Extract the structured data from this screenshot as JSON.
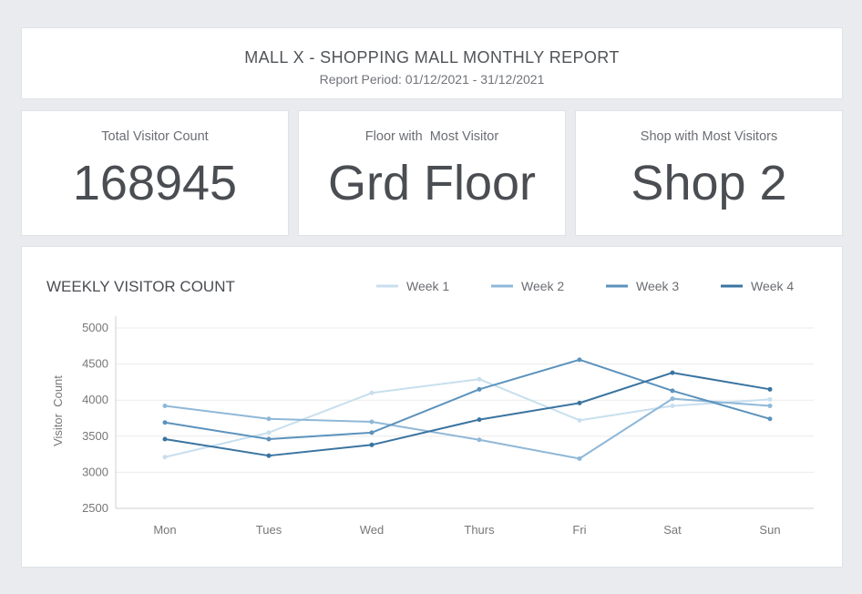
{
  "header": {
    "title": "MALL X - SHOPPING MALL MONTHLY REPORT",
    "subtitle": "Report Period: 01/12/2021 - 31/12/2021"
  },
  "kpis": [
    {
      "label": "Total Visitor Count",
      "value": "168945"
    },
    {
      "label": "Floor with  Most Visitor",
      "value": "Grd Floor"
    },
    {
      "label": "Shop with Most Visitors",
      "value": "Shop 2"
    }
  ],
  "chart_data": {
    "type": "line",
    "title": "WEEKLY VISITOR COUNT",
    "xlabel": "",
    "ylabel": "Visitor  Count",
    "categories": [
      "Mon",
      "Tues",
      "Wed",
      "Thurs",
      "Fri",
      "Sat",
      "Sun"
    ],
    "ylim": [
      2500,
      5000
    ],
    "yticks": [
      2500,
      3000,
      3500,
      4000,
      4500,
      5000
    ],
    "grid": true,
    "legend_position": "top-right",
    "series": [
      {
        "name": "Week 1",
        "color": "#c8dfee",
        "values": [
          3210,
          3550,
          4100,
          4290,
          3720,
          3920,
          4010
        ]
      },
      {
        "name": "Week 2",
        "color": "#8fb8d8",
        "values": [
          3920,
          3740,
          3700,
          3450,
          3190,
          4020,
          3920
        ]
      },
      {
        "name": "Week 3",
        "color": "#5b92bd",
        "values": [
          3690,
          3460,
          3550,
          4150,
          4560,
          4130,
          3740
        ]
      },
      {
        "name": "Week 4",
        "color": "#3a74a0",
        "values": [
          3460,
          3230,
          3380,
          3730,
          3960,
          4380,
          4150
        ]
      }
    ]
  }
}
